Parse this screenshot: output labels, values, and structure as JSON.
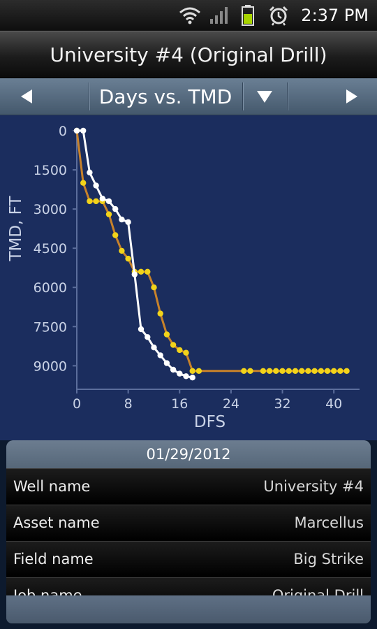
{
  "status_bar": {
    "time": "2:37 PM",
    "icons": [
      "wifi-icon",
      "signal-icon",
      "battery-icon",
      "alarm-icon"
    ],
    "battery_color": "#a8d400"
  },
  "title_bar": {
    "title": "University #4 (Original Drill)"
  },
  "chart_nav": {
    "title": "Days vs. TMD",
    "prev_icon": "left-arrow-icon",
    "dropdown_icon": "down-triangle-icon",
    "next_icon": "right-arrow-icon"
  },
  "chart_data": {
    "type": "line",
    "xlabel": "DFS",
    "ylabel": "TMD, FT",
    "xlim": [
      0,
      44
    ],
    "ylim": [
      9900,
      0
    ],
    "y_inverted": true,
    "x_ticks": [
      "0",
      "8",
      "16",
      "24",
      "32",
      "40"
    ],
    "y_ticks": [
      "0",
      "1500",
      "3000",
      "4500",
      "6000",
      "7500",
      "9000"
    ],
    "grid": false,
    "legend": "none",
    "series": [
      {
        "color": "#ffffff",
        "line_color": "#ffffff",
        "x": [
          0,
          1,
          2,
          3,
          4,
          5,
          6,
          7,
          8,
          9,
          10,
          11,
          12,
          13,
          14,
          15,
          16,
          17,
          18
        ],
        "y": [
          0,
          0,
          1600,
          2100,
          2600,
          2700,
          3000,
          3400,
          3500,
          5500,
          7600,
          7900,
          8300,
          8600,
          8900,
          9150,
          9300,
          9400,
          9450
        ]
      },
      {
        "color": "#f2d31a",
        "line_color": "#c8822a",
        "x": [
          0,
          1,
          2,
          3,
          4,
          5,
          6,
          7,
          8,
          9,
          10,
          11,
          12,
          13,
          14,
          15,
          16,
          17,
          18,
          19,
          26,
          27,
          29,
          30,
          31,
          32,
          33,
          34,
          35,
          36,
          37,
          38,
          39,
          40,
          41,
          42
        ],
        "y": [
          0,
          2000,
          2700,
          2700,
          2700,
          3200,
          4000,
          4600,
          4900,
          5400,
          5400,
          5400,
          6000,
          7000,
          7800,
          8200,
          8400,
          8500,
          9200,
          9200,
          9200,
          9200,
          9200,
          9200,
          9200,
          9200,
          9200,
          9200,
          9200,
          9200,
          9200,
          9200,
          9200,
          9200,
          9200,
          9200
        ]
      }
    ]
  },
  "info_panel": {
    "date": "01/29/2012",
    "rows": [
      {
        "label": "Well name",
        "value": "University #4"
      },
      {
        "label": "Asset name",
        "value": "Marcellus"
      },
      {
        "label": "Field name",
        "value": "Big Strike"
      },
      {
        "label": "Job name",
        "value": "Original Drill"
      }
    ]
  }
}
